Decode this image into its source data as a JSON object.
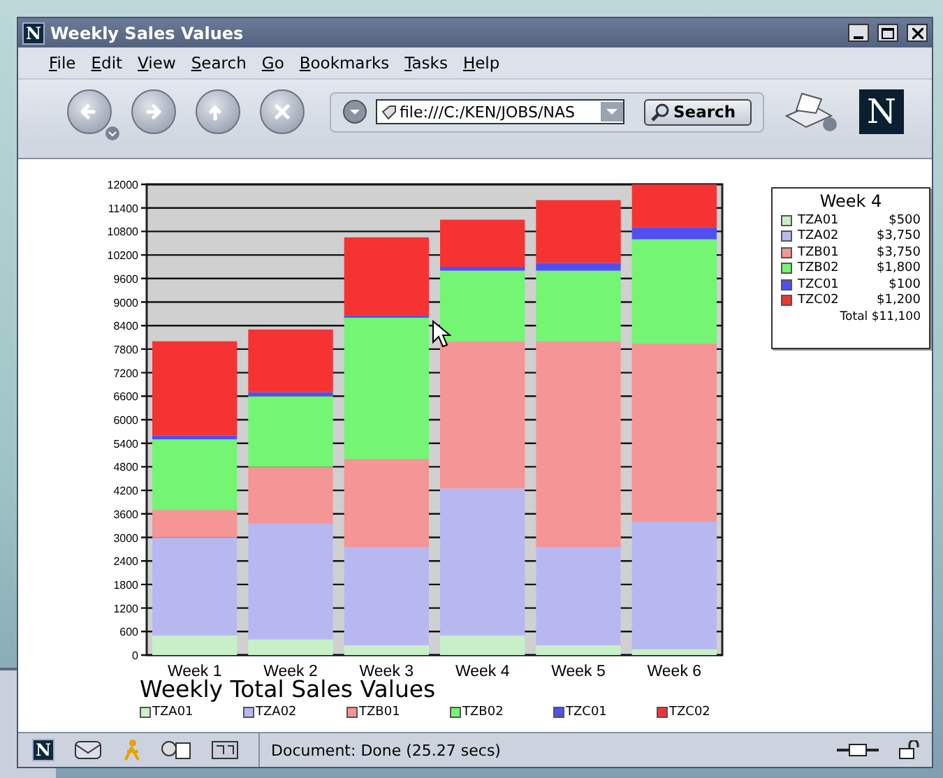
{
  "window": {
    "logo": "N",
    "title": "Weekly Sales Values"
  },
  "menu": [
    "File",
    "Edit",
    "View",
    "Search",
    "Go",
    "Bookmarks",
    "Tasks",
    "Help"
  ],
  "toolbar": {
    "url": "file:///C:/KEN/JOBS/NAS",
    "search_button": "Search",
    "throbber": "N"
  },
  "content": {
    "chart": {
      "chart_data": {
        "type": "bar",
        "stacked": true,
        "title": "Weekly Total Sales Values",
        "categories": [
          "Week 1",
          "Week 2",
          "Week 3",
          "Week 4",
          "Week 5",
          "Week 6"
        ],
        "ylim": [
          0,
          12000
        ],
        "yticks": [
          0,
          600,
          1200,
          1800,
          2400,
          3000,
          3600,
          4200,
          4800,
          5400,
          6000,
          6600,
          7200,
          7800,
          8400,
          9000,
          9600,
          10200,
          10800,
          11400,
          12000
        ],
        "series": [
          {
            "name": "TZA01",
            "color": "#c8f0c8",
            "values": [
              500,
              400,
              250,
              500,
              250,
              150
            ]
          },
          {
            "name": "TZA02",
            "color": "#b8b8f0",
            "values": [
              2500,
              2950,
              2500,
              3750,
              2500,
              3250
            ]
          },
          {
            "name": "TZB01",
            "color": "#f59595",
            "values": [
              700,
              1450,
              2250,
              3750,
              5250,
              4550
            ]
          },
          {
            "name": "TZB02",
            "color": "#74f574",
            "values": [
              1800,
              1800,
              3600,
              1800,
              1800,
              2650
            ]
          },
          {
            "name": "TZC01",
            "color": "#5050f0",
            "values": [
              100,
              100,
              50,
              100,
              200,
              300
            ]
          },
          {
            "name": "TZC02",
            "color": "#f53333",
            "values": [
              2400,
              1600,
              2000,
              1200,
              1600,
              1100
            ]
          }
        ],
        "grid": true
      }
    },
    "legend_box": {
      "title": "Week 4",
      "items": [
        {
          "name": "TZA01",
          "value": "$500",
          "color": "#c8f0c8"
        },
        {
          "name": "TZA02",
          "value": "$3,750",
          "color": "#b8b8f0"
        },
        {
          "name": "TZB01",
          "value": "$3,750",
          "color": "#f59595"
        },
        {
          "name": "TZB02",
          "value": "$1,800",
          "color": "#74f574"
        },
        {
          "name": "TZC01",
          "value": "$100",
          "color": "#5050f0"
        },
        {
          "name": "TZC02",
          "value": "$1,200",
          "color": "#f53333"
        }
      ],
      "total": "Total $11,100"
    }
  },
  "status_bar": {
    "logo": "N",
    "text": "Document: Done (25.27 secs)"
  }
}
